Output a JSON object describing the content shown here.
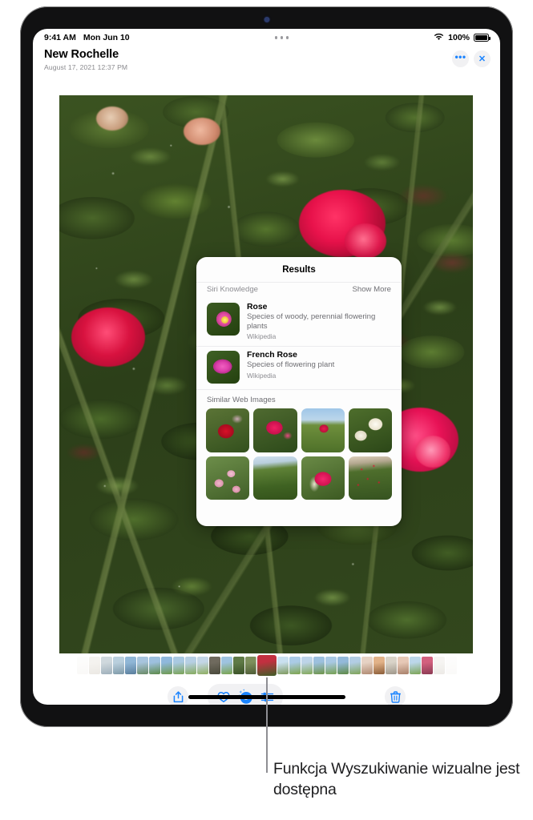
{
  "status_bar": {
    "time": "9:41 AM",
    "date": "Mon Jun 10",
    "wifi_icon": "wifi-icon",
    "battery_percent": "100%",
    "battery_icon": "battery-full-icon",
    "multitask_handle_icon": "multitasking-dots-icon"
  },
  "header": {
    "title": "New Rochelle",
    "subtitle": "August 17, 2021  12:37 PM",
    "more_button_label": "•••",
    "more_button_icon": "ellipsis-icon",
    "close_button_label": "✕",
    "close_button_icon": "close-x-icon"
  },
  "photo": {
    "name": "rose-bush-photo",
    "alt_subject": "Rose bush with red and pink roses and green foliage"
  },
  "popover": {
    "title": "Results",
    "section_label": "Siri Knowledge",
    "show_more_label": "Show More",
    "knowledge_items": [
      {
        "name": "Rose",
        "description": "Species of woody, perennial flowering plants",
        "source": "Wikipedia",
        "thumb": "pink-rose-thumbnail"
      },
      {
        "name": "French Rose",
        "description": "Species of flowering plant",
        "source": "Wikipedia",
        "thumb": "magenta-rose-thumbnail"
      }
    ],
    "similar_images_label": "Similar Web Images",
    "similar_images": [
      {
        "name": "red-rose-closeup"
      },
      {
        "name": "magenta-rose-bush"
      },
      {
        "name": "rose-against-sky"
      },
      {
        "name": "white-roses"
      },
      {
        "name": "pale-pink-roses"
      },
      {
        "name": "rose-garden-rows"
      },
      {
        "name": "pink-rose-bud"
      },
      {
        "name": "red-rose-shrub-with-label"
      }
    ]
  },
  "filmstrip": {
    "name": "photo-filmstrip",
    "selected_index": 15,
    "thumbnails": [
      {
        "name": "thumb-1",
        "c1": "#e8e4dc",
        "c2": "#cfc8bb"
      },
      {
        "name": "thumb-2",
        "c1": "#dcd6ca",
        "c2": "#bdb4a4"
      },
      {
        "name": "thumb-3",
        "c1": "#cfd8dd",
        "c2": "#9fb0bb"
      },
      {
        "name": "thumb-4",
        "c1": "#b9cfdd",
        "c2": "#7f9aa8"
      },
      {
        "name": "thumb-5",
        "c1": "#8fb6d6",
        "c2": "#5a7e9c"
      },
      {
        "name": "thumb-6",
        "c1": "#a7c4dd",
        "c2": "#6a8a66"
      },
      {
        "name": "thumb-7",
        "c1": "#9dc0de",
        "c2": "#5d8a4a"
      },
      {
        "name": "thumb-8",
        "c1": "#8fb8dc",
        "c2": "#6f9a4e"
      },
      {
        "name": "thumb-9",
        "c1": "#a9c9e2",
        "c2": "#7aa356"
      },
      {
        "name": "thumb-10",
        "c1": "#b6cfe4",
        "c2": "#86ab5e"
      },
      {
        "name": "thumb-11",
        "c1": "#c3d6e6",
        "c2": "#8fae62"
      },
      {
        "name": "thumb-12",
        "c1": "#6f6a5e",
        "c2": "#4a4a3c"
      },
      {
        "name": "thumb-13",
        "c1": "#9ec3e0",
        "c2": "#7aa44e"
      },
      {
        "name": "thumb-14",
        "c1": "#5f7a46",
        "c2": "#3a5228"
      },
      {
        "name": "thumb-15",
        "c1": "#7d8f5c",
        "c2": "#4e5c36"
      },
      {
        "name": "thumb-16",
        "c1": "#c23040",
        "c2": "#3f5e28"
      },
      {
        "name": "thumb-17",
        "c1": "#c9e0ef",
        "c2": "#7f9a5e"
      },
      {
        "name": "thumb-18",
        "c1": "#aacbe6",
        "c2": "#7ea44e"
      },
      {
        "name": "thumb-19",
        "c1": "#bdd4e8",
        "c2": "#83a95a"
      },
      {
        "name": "thumb-20",
        "c1": "#9cc0de",
        "c2": "#6e9448"
      },
      {
        "name": "thumb-21",
        "c1": "#a8c8e3",
        "c2": "#76a052"
      },
      {
        "name": "thumb-22",
        "c1": "#93b9da",
        "c2": "#5f8a46"
      },
      {
        "name": "thumb-23",
        "c1": "#b2cde4",
        "c2": "#7fa458"
      },
      {
        "name": "thumb-24",
        "c1": "#e6d2c4",
        "c2": "#b08a72"
      },
      {
        "name": "thumb-25",
        "c1": "#e2b288",
        "c2": "#8a5c38"
      },
      {
        "name": "thumb-26",
        "c1": "#d9d3c8",
        "c2": "#9f978a"
      },
      {
        "name": "thumb-27",
        "c1": "#e6c8b6",
        "c2": "#a8806a"
      },
      {
        "name": "thumb-28",
        "c1": "#bcd7ea",
        "c2": "#7ca455"
      },
      {
        "name": "thumb-29",
        "c1": "#d2607e",
        "c2": "#8a3a52"
      },
      {
        "name": "thumb-30",
        "c1": "#e0dcd4",
        "c2": "#c0b8ac"
      },
      {
        "name": "thumb-31",
        "c1": "#ece8e2",
        "c2": "#d6cfc6"
      }
    ]
  },
  "toolbar": {
    "share_label": "Share",
    "share_icon": "share-up-arrow-icon",
    "favorite_label": "Favorite",
    "favorite_icon": "heart-icon",
    "visual_lookup_label": "Visual Look Up",
    "visual_lookup_icon": "info-sparkle-icon",
    "visual_lookup_active": true,
    "adjust_label": "Adjust",
    "adjust_icon": "sliders-icon",
    "delete_label": "Delete",
    "delete_icon": "trash-icon"
  },
  "callout": {
    "text": "Funkcja Wyszukiwanie wizualne jest dostępna",
    "leader_line": "callout-leader-line"
  },
  "colors": {
    "accent_blue": "#1a84ff",
    "pill_gray": "#f1f1f3",
    "secondary_text": "#8a8a8e",
    "caption_text": "#1d1d1f",
    "leader_gray": "#8e8e93"
  }
}
